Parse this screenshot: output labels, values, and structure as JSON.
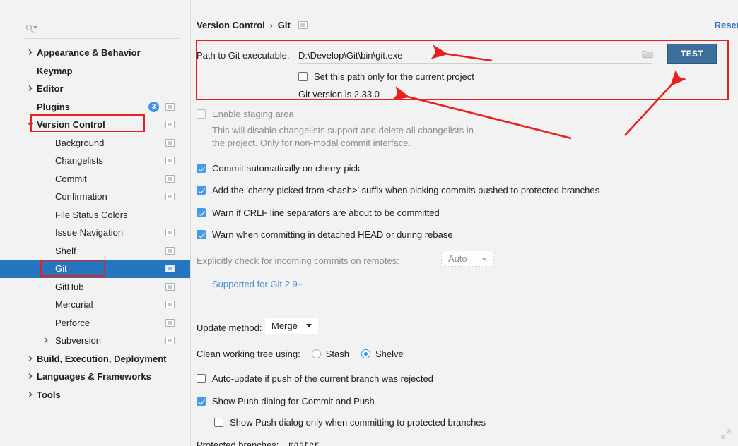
{
  "sidebar": {
    "search": {
      "value": "",
      "placeholder": "",
      "icon": "search-icon"
    },
    "items": [
      {
        "label": "Appearance & Behavior",
        "level": 0,
        "arrow": "right",
        "bold": true,
        "gear": false,
        "badge": null,
        "selected": false
      },
      {
        "label": "Keymap",
        "level": 0,
        "arrow": "none",
        "bold": true,
        "gear": false,
        "badge": null,
        "selected": false
      },
      {
        "label": "Editor",
        "level": 0,
        "arrow": "right",
        "bold": true,
        "gear": false,
        "badge": null,
        "selected": false
      },
      {
        "label": "Plugins",
        "level": 0,
        "arrow": "none",
        "bold": true,
        "gear": true,
        "badge": "3",
        "selected": false
      },
      {
        "label": "Version Control",
        "level": 0,
        "arrow": "down",
        "bold": true,
        "gear": true,
        "badge": null,
        "selected": false
      },
      {
        "label": "Background",
        "level": 1,
        "arrow": "none",
        "bold": false,
        "gear": true,
        "badge": null,
        "selected": false
      },
      {
        "label": "Changelists",
        "level": 1,
        "arrow": "none",
        "bold": false,
        "gear": true,
        "badge": null,
        "selected": false
      },
      {
        "label": "Commit",
        "level": 1,
        "arrow": "none",
        "bold": false,
        "gear": true,
        "badge": null,
        "selected": false
      },
      {
        "label": "Confirmation",
        "level": 1,
        "arrow": "none",
        "bold": false,
        "gear": true,
        "badge": null,
        "selected": false
      },
      {
        "label": "File Status Colors",
        "level": 1,
        "arrow": "none",
        "bold": false,
        "gear": false,
        "badge": null,
        "selected": false
      },
      {
        "label": "Issue Navigation",
        "level": 1,
        "arrow": "none",
        "bold": false,
        "gear": true,
        "badge": null,
        "selected": false
      },
      {
        "label": "Shelf",
        "level": 1,
        "arrow": "none",
        "bold": false,
        "gear": true,
        "badge": null,
        "selected": false
      },
      {
        "label": "Git",
        "level": 1,
        "arrow": "none",
        "bold": false,
        "gear": true,
        "badge": null,
        "selected": true
      },
      {
        "label": "GitHub",
        "level": 1,
        "arrow": "none",
        "bold": false,
        "gear": true,
        "badge": null,
        "selected": false
      },
      {
        "label": "Mercurial",
        "level": 1,
        "arrow": "none",
        "bold": false,
        "gear": true,
        "badge": null,
        "selected": false
      },
      {
        "label": "Perforce",
        "level": 1,
        "arrow": "none",
        "bold": false,
        "gear": true,
        "badge": null,
        "selected": false
      },
      {
        "label": "Subversion",
        "level": 1,
        "arrow": "right",
        "bold": false,
        "gear": true,
        "badge": null,
        "selected": false
      },
      {
        "label": "Build, Execution, Deployment",
        "level": 0,
        "arrow": "right",
        "bold": true,
        "gear": false,
        "badge": null,
        "selected": false
      },
      {
        "label": "Languages & Frameworks",
        "level": 0,
        "arrow": "right",
        "bold": true,
        "gear": false,
        "badge": null,
        "selected": false
      },
      {
        "label": "Tools",
        "level": 0,
        "arrow": "right",
        "bold": true,
        "gear": false,
        "badge": null,
        "selected": false
      }
    ]
  },
  "header": {
    "breadcrumb_parent": "Version Control",
    "breadcrumb_sep": "›",
    "breadcrumb_current": "Git",
    "breadcrumb_icon": "settings-indicator-icon",
    "reset_label": "Reset"
  },
  "git_settings": {
    "path_label": "Path to Git executable:",
    "path_value": "D:\\Develop\\Git\\bin\\git.exe",
    "browse_icon": "folder-icon",
    "test_button": "TEST",
    "project_only_checkbox": {
      "label": "Set this path only for the current project",
      "checked": false,
      "disabled": false
    },
    "git_version": "Git version is 2.33.0",
    "staging": {
      "label": "Enable staging area",
      "checked": false,
      "disabled": true
    },
    "staging_desc_line1": "This will disable changelists support and delete all changelists in",
    "staging_desc_line2": "the project. Only for non-modal commit interface.",
    "options": [
      {
        "label": "Commit automatically on cherry-pick",
        "checked": true,
        "disabled": false
      },
      {
        "label": "Add the 'cherry-picked from <hash>' suffix when picking commits pushed to protected branches",
        "checked": true,
        "disabled": false
      },
      {
        "label": "Warn if CRLF line separators are about to be committed",
        "checked": true,
        "disabled": false
      },
      {
        "label": "Warn when committing in detached HEAD or during rebase",
        "checked": true,
        "disabled": false
      }
    ],
    "incoming": {
      "label": "Explicitly check for incoming commits on remotes:",
      "value": "Auto",
      "disabled": true,
      "note": "Supported for Git 2.9+"
    },
    "update_method": {
      "label": "Update method:",
      "value": "Merge"
    },
    "clean_tree": {
      "label": "Clean working tree using:",
      "option1": "Stash",
      "option2": "Shelve",
      "selected": "Shelve"
    },
    "auto_update": {
      "label": "Auto-update if push of the current branch was rejected",
      "checked": false
    },
    "show_push": {
      "label": "Show Push dialog for Commit and Push",
      "checked": true
    },
    "show_push_protected": {
      "label": "Show Push dialog only when committing to protected branches",
      "checked": false
    },
    "protected_branches": {
      "label": "Protected branches:",
      "value": "master"
    },
    "resize_icon": "resize-corner-icon"
  },
  "annotations": {
    "accent_color": "#e8201f",
    "boxes": [
      {
        "name": "version-control-highlight"
      },
      {
        "name": "git-item-highlight"
      },
      {
        "name": "git-path-section-highlight"
      }
    ],
    "arrows": [
      {
        "name": "arrow-to-git-path"
      },
      {
        "name": "arrow-to-git-version"
      },
      {
        "name": "arrow-to-test-button"
      }
    ]
  }
}
